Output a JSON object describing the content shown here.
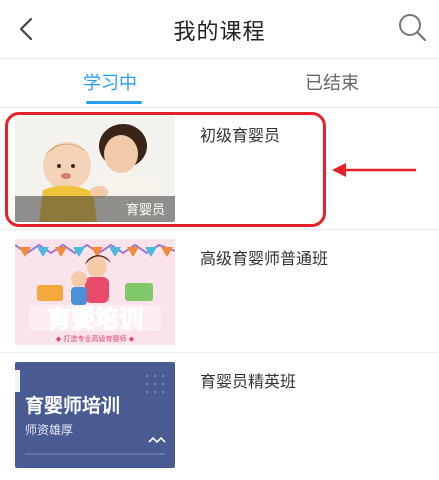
{
  "header": {
    "title": "我的课程"
  },
  "tabs": [
    {
      "label": "学习中",
      "active": true
    },
    {
      "label": "已结束",
      "active": false
    }
  ],
  "courses": [
    {
      "name": "初级育婴员",
      "thumb_caption": "育婴员"
    },
    {
      "name": "高级育婴师普通班",
      "thumb_title": "育婴培训",
      "thumb_subtitle": "◆ 打造专业高级育婴师 ◆"
    },
    {
      "name": "育婴员精英班",
      "thumb_title": "育婴师培训",
      "thumb_subtitle": "师资雄厚"
    }
  ],
  "colors": {
    "accent": "#2a9df4",
    "highlight": "#e8202a",
    "card_blue": "#4a5a92"
  },
  "icons": {
    "back": "chevron-left-icon",
    "search": "search-icon",
    "pointer": "arrow-left-icon"
  }
}
